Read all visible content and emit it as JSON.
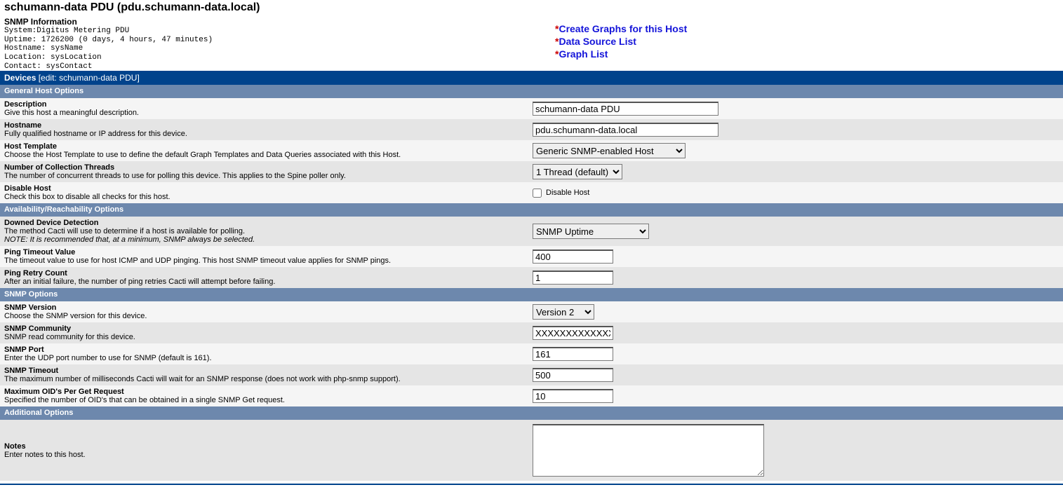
{
  "header": {
    "title": "schumann-data PDU (pdu.schumann-data.local)",
    "snmp_title": "SNMP Information",
    "system": "System:Digitus Metering PDU",
    "uptime": "Uptime: 1726200 (0 days, 4 hours, 47 minutes)",
    "hostname": "Hostname: sysName",
    "location": "Location: sysLocation",
    "contact": "Contact: sysContact"
  },
  "links": {
    "create_graphs": "Create Graphs for this Host",
    "data_source_list": "Data Source List",
    "graph_list": "Graph List"
  },
  "bars": {
    "devices": "Devices",
    "devices_edit": "[edit: schumann-data PDU]",
    "general": "General Host Options",
    "availability": "Availability/Reachability Options",
    "snmp": "SNMP Options",
    "additional": "Additional Options"
  },
  "fields": {
    "description": {
      "label": "Description",
      "hint": "Give this host a meaningful description.",
      "value": "schumann-data PDU"
    },
    "hostname": {
      "label": "Hostname",
      "hint": "Fully qualified hostname or IP address for this device.",
      "value": "pdu.schumann-data.local"
    },
    "host_template": {
      "label": "Host Template",
      "hint": "Choose the Host Template to use to define the default Graph Templates and Data Queries associated with this Host.",
      "value": "Generic SNMP-enabled Host"
    },
    "threads": {
      "label": "Number of Collection Threads",
      "hint": "The number of concurrent threads to use for polling this device. This applies to the Spine poller only.",
      "value": "1 Thread (default)"
    },
    "disable": {
      "label": "Disable Host",
      "hint": "Check this box to disable all checks for this host.",
      "cb_label": "Disable Host"
    },
    "downed": {
      "label": "Downed Device Detection",
      "hint": "The method Cacti will use to determine if a host is available for polling.",
      "note": "NOTE: It is recommended that, at a minimum, SNMP always be selected.",
      "value": "SNMP Uptime"
    },
    "ping_timeout": {
      "label": "Ping Timeout Value",
      "hint": "The timeout value to use for host ICMP and UDP pinging. This host SNMP timeout value applies for SNMP pings.",
      "value": "400"
    },
    "ping_retry": {
      "label": "Ping Retry Count",
      "hint": "After an initial failure, the number of ping retries Cacti will attempt before failing.",
      "value": "1"
    },
    "snmp_version": {
      "label": "SNMP Version",
      "hint": "Choose the SNMP version for this device.",
      "value": "Version 2"
    },
    "snmp_community": {
      "label": "SNMP Community",
      "hint": "SNMP read community for this device.",
      "value": "XXXXXXXXXXXXXX"
    },
    "snmp_port": {
      "label": "SNMP Port",
      "hint": "Enter the UDP port number to use for SNMP (default is 161).",
      "value": "161"
    },
    "snmp_timeout": {
      "label": "SNMP Timeout",
      "hint": "The maximum number of milliseconds Cacti will wait for an SNMP response (does not work with php-snmp support).",
      "value": "500"
    },
    "max_oid": {
      "label": "Maximum OID's Per Get Request",
      "hint": "Specified the number of OID's that can be obtained in a single SNMP Get request.",
      "value": "10"
    },
    "notes": {
      "label": "Notes",
      "hint": "Enter notes to this host.",
      "value": ""
    }
  }
}
